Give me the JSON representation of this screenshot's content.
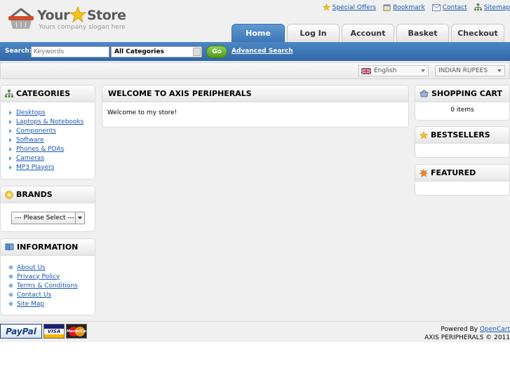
{
  "header": {
    "logo": {
      "word1": "Your",
      "word2": "Store",
      "slogan": "Yours company slogan here"
    },
    "links": [
      {
        "label": "Special Offers",
        "icon": "star-icon"
      },
      {
        "label": "Bookmark",
        "icon": "bookmark-icon"
      },
      {
        "label": "Contact",
        "icon": "mail-icon"
      },
      {
        "label": "Sitemap",
        "icon": "sitemap-icon"
      }
    ],
    "tabs": [
      {
        "label": "Home",
        "active": true
      },
      {
        "label": "Log In"
      },
      {
        "label": "Account"
      },
      {
        "label": "Basket"
      },
      {
        "label": "Checkout"
      }
    ]
  },
  "search": {
    "label": "Search:",
    "placeholder": "Keywords",
    "category": "All Categories",
    "go_label": "Go",
    "advanced_label": "Advanced Search"
  },
  "locale": {
    "language": "English",
    "currency": "INDIAN RUPEES"
  },
  "left": {
    "categories": {
      "title": "CATEGORIES",
      "items": [
        "Desktops",
        "Laptops & Notebooks",
        "Components",
        "Software",
        "Phones & PDAs",
        "Cameras",
        "MP3 Players"
      ]
    },
    "brands": {
      "title": "BRANDS",
      "select": "--- Please Select ---"
    },
    "information": {
      "title": "INFORMATION",
      "items": [
        "About Us",
        "Privacy Policy",
        "Terms & Conditions",
        "Contact Us",
        "Site Map"
      ]
    }
  },
  "center": {
    "title": "WELCOME TO AXIS PERIPHERALS",
    "text": "Welcome to my store!"
  },
  "right": {
    "cart": {
      "title": "SHOPPING CART",
      "text": "0 items"
    },
    "bestsellers": {
      "title": "BESTSELLERS"
    },
    "featured": {
      "title": "FEATURED"
    }
  },
  "footer": {
    "payments": {
      "paypal": "PayPal",
      "visa": "VISA",
      "mastercard": "MasterCard"
    },
    "powered_prefix": "Powered By",
    "powered_link": "OpenCart",
    "copyright": "AXIS PERIPHERALS © 2011"
  },
  "colors": {
    "accent": "#3d76b5",
    "link": "#1b57b1",
    "go": "#5aa626"
  }
}
